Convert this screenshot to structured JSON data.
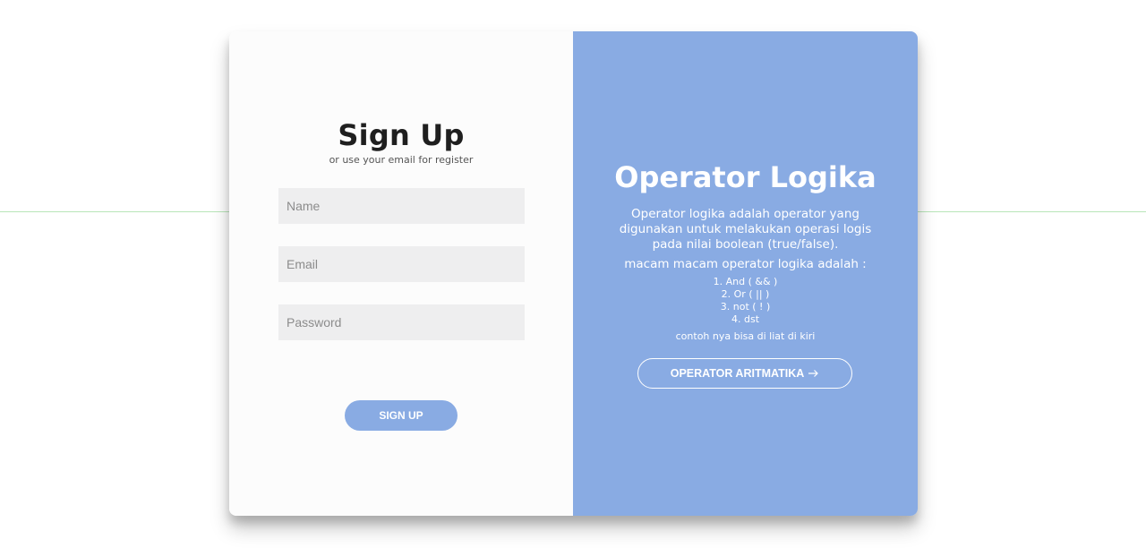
{
  "signup": {
    "title": "Sign Up",
    "subtitle": "or use your email for register",
    "fields": {
      "name_placeholder": "Name",
      "email_placeholder": "Email",
      "password_placeholder": "Password"
    },
    "button_label": "SIGN UP"
  },
  "info": {
    "title": "Operator Logika",
    "description": "Operator logika adalah operator yang digunakan untuk melakukan operasi logis pada nilai boolean (true/false).",
    "subhead": "macam macam operator logika adalah :",
    "operators": [
      "1. And ( && )",
      "2. Or ( || )",
      "3. not ( ! )",
      "4. dst"
    ],
    "example_note": "contoh nya bisa di liat di kiri",
    "button_label": "OPERATOR ARITMATIKA",
    "button_icon": "arrow-right-icon"
  },
  "colors": {
    "accent": "#89abe3",
    "card_background": "#fcfcfc",
    "input_background": "#eeeeef"
  }
}
